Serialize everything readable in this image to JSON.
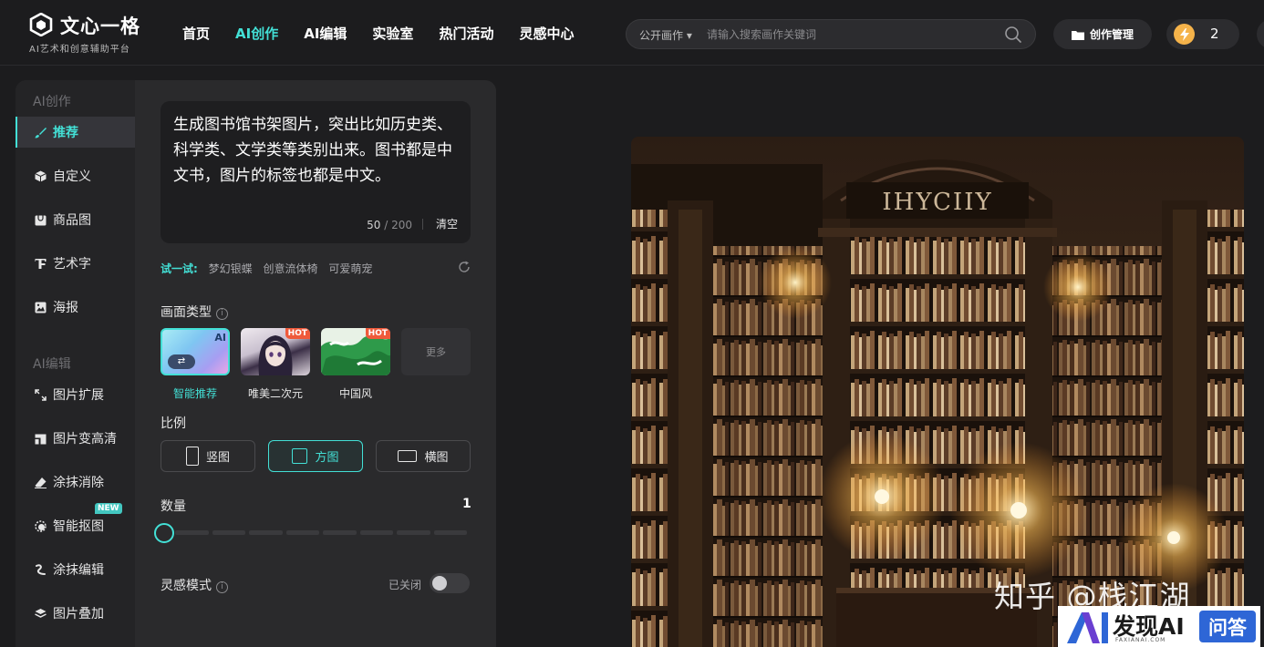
{
  "brand": {
    "name": "文心一格",
    "tagline": "AI艺术和创意辅助平台"
  },
  "nav": [
    {
      "label": "首页",
      "active": false
    },
    {
      "label": "AI创作",
      "active": true
    },
    {
      "label": "AI编辑",
      "active": false
    },
    {
      "label": "实验室",
      "active": false
    },
    {
      "label": "热门活动",
      "active": false
    },
    {
      "label": "灵感中心",
      "active": false
    }
  ],
  "search": {
    "scope": "公开画作",
    "placeholder": "请输入搜索画作关键词"
  },
  "header": {
    "manage_label": "创作管理",
    "credits": "2"
  },
  "sidebar": {
    "section_create": "AI创作",
    "create_items": [
      {
        "label": "推荐",
        "icon": "brush-icon",
        "active": true
      },
      {
        "label": "自定义",
        "icon": "cube-icon",
        "active": false
      },
      {
        "label": "商品图",
        "icon": "product-icon",
        "active": false
      },
      {
        "label": "艺术字",
        "icon": "text-art-icon",
        "active": false
      },
      {
        "label": "海报",
        "icon": "poster-icon",
        "active": false
      }
    ],
    "section_edit": "AI编辑",
    "edit_items": [
      {
        "label": "图片扩展",
        "icon": "expand-icon"
      },
      {
        "label": "图片变高清",
        "icon": "hd-icon"
      },
      {
        "label": "涂抹消除",
        "icon": "eraser-icon"
      },
      {
        "label": "智能抠图",
        "icon": "cutout-icon",
        "badge": "NEW"
      },
      {
        "label": "涂抹编辑",
        "icon": "smear-edit-icon"
      },
      {
        "label": "图片叠加",
        "icon": "layers-icon"
      }
    ]
  },
  "prompt": {
    "text": "生成图书馆书架图片，突出比如历史类、科学类、文学类等类别出来。图书都是中文书，图片的标签也都是中文。",
    "count": "50",
    "max": "200",
    "clear_label": "清空"
  },
  "try": {
    "label": "试一试:",
    "chips": [
      "梦幻银蝶",
      "创意流体椅",
      "可爱萌宠"
    ]
  },
  "style_type": {
    "label": "画面类型",
    "options": [
      {
        "label": "智能推荐",
        "badge": "AI",
        "active": true
      },
      {
        "label": "唯美二次元",
        "badge": "HOT",
        "active": false
      },
      {
        "label": "中国风",
        "badge": "HOT",
        "active": false
      }
    ],
    "more_label": "更多"
  },
  "ratio": {
    "label": "比例",
    "options": [
      {
        "label": "竖图",
        "active": false
      },
      {
        "label": "方图",
        "active": true
      },
      {
        "label": "横图",
        "active": false
      }
    ]
  },
  "quantity": {
    "label": "数量",
    "value": "1"
  },
  "inspiration": {
    "label": "灵感模式",
    "state_label": "已关闭",
    "on": false
  },
  "canvas": {
    "sign_text": "IHYCIIY"
  },
  "watermark": {
    "text": "知乎 @栈江湖",
    "faxian_word": "发现AI",
    "faxian_domain": "FAXIANAI.COM",
    "faxian_qa": "问答"
  },
  "colors": {
    "accent": "#43e0d6",
    "hot": "#ef5a3b",
    "bg": "#1c1c1e",
    "panel": "#2a2a2c"
  }
}
